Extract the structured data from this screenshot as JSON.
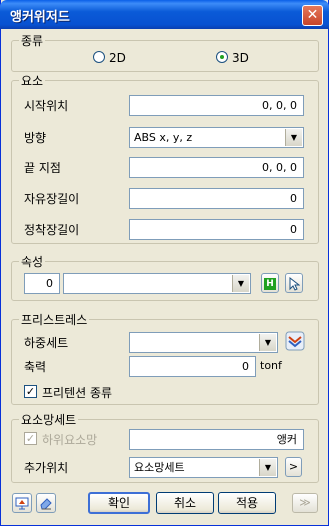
{
  "window": {
    "title": "앵커위저드",
    "close_glyph": "✕"
  },
  "type_group": {
    "label": "종류",
    "options": [
      "2D",
      "3D"
    ],
    "selected": "3D"
  },
  "element_group": {
    "label": "요소",
    "start_pos_label": "시작위치",
    "start_pos_value": "0, 0, 0",
    "direction_label": "방향",
    "direction_value": "ABS x, y, z",
    "end_node_label": "끝 지점",
    "end_node_value": "0, 0, 0",
    "free_len_label": "자유장길이",
    "free_len_value": "0",
    "fixed_len_label": "정착장길이",
    "fixed_len_value": "0"
  },
  "property_group": {
    "label": "속성",
    "number_value": "0",
    "property_select_value": "",
    "icons": [
      "property-table-icon",
      "pointer-select-icon"
    ],
    "table_icon_glyph": "H"
  },
  "prestress_group": {
    "label": "프리스트레스",
    "load_set_label": "하중세트",
    "load_set_value": "",
    "axial_label": "축력",
    "axial_value": "0",
    "axial_unit": "tonf",
    "friction_label": "프리텐션 종류",
    "friction_checked": true
  },
  "mesh_group": {
    "label": "요소망세트",
    "sub_label": "하위요소망",
    "sub_checked": true,
    "sub_disabled": true,
    "sub_value": "앵커",
    "add_pos_label": "추가위치",
    "add_pos_value": "요소망세트",
    "go_glyph": ">"
  },
  "footer": {
    "ok": "확인",
    "cancel": "취소",
    "apply": "적용",
    "more_glyph": "≫"
  },
  "check_glyph": "✓",
  "colors": {
    "title_bar": "#0a5fe8",
    "dialog_bg": "#ece9d8",
    "field_border": "#7f9db9"
  }
}
